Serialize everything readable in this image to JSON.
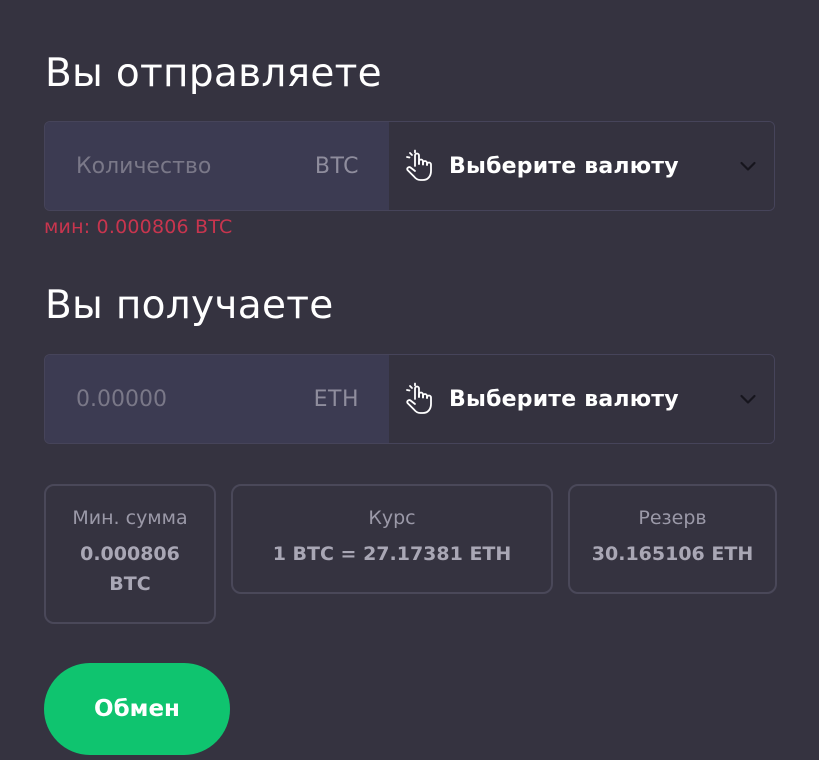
{
  "send": {
    "title": "Вы отправляете",
    "amount_placeholder": "Количество",
    "amount_value": "",
    "currency": "BTC",
    "select_label": "Выберите валюту",
    "min_error": "мин: 0.000806 BTC"
  },
  "receive": {
    "title": "Вы получаете",
    "amount_placeholder": "0.00000",
    "amount_value": "",
    "currency": "ETH",
    "select_label": "Выберите валюту"
  },
  "info": {
    "min_sum": {
      "label": "Мин. сумма",
      "value": "0.000806 BTC"
    },
    "rate": {
      "label": "Курс",
      "value": "1 BTC = 27.17381 ETH"
    },
    "reserve": {
      "label": "Резерв",
      "value": "30.165106 ETH"
    }
  },
  "actions": {
    "exchange_label": "Обмен"
  },
  "icons": {
    "select_pointer": "hand-pointer-icon",
    "dropdown": "chevron-down-icon"
  },
  "colors": {
    "background": "#353340",
    "input_bg": "#3c3b52",
    "error": "#c8354e",
    "accent": "#0fc46f"
  }
}
